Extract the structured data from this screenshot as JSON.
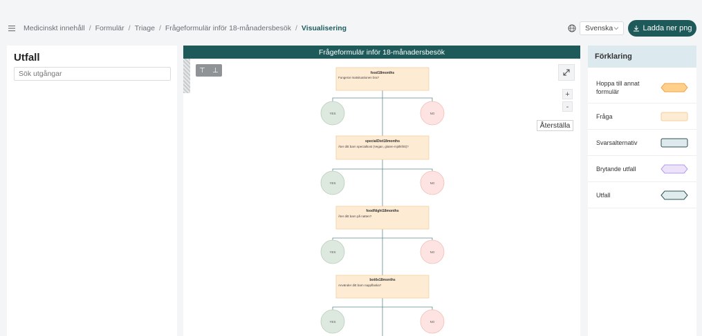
{
  "breadcrumb": {
    "items": [
      "Medicinskt innehåll",
      "Formulär",
      "Triage",
      "Frågeformulär inför 18-månadersbesök"
    ],
    "current": "Visualisering",
    "separator": "/"
  },
  "header": {
    "language": "Svenska",
    "download_label": "Ladda ner png"
  },
  "left_panel": {
    "title": "Utfall",
    "search_placeholder": "Sök utgångar"
  },
  "canvas": {
    "title": "Frågeformulär inför 18-månadersbesök",
    "align_top": "⊤",
    "align_bottom": "⊥",
    "zoom_in": "+",
    "zoom_out": "-",
    "reset_label": "Återställa",
    "questions": [
      {
        "id": "food18months",
        "text": "Fungerar matsituationen bra?"
      },
      {
        "id": "specialDiet18months",
        "text": "Äter ditt barn specialkost (Vegan, gluten-mjölkfritt)?"
      },
      {
        "id": "foodNight18months",
        "text": "Äter ditt barn på natten?"
      },
      {
        "id": "bottle18months",
        "text": "Använder ditt barn nappflaska?"
      }
    ],
    "yes_label": "YES",
    "no_label": "NO"
  },
  "legend": {
    "title": "Förklaring",
    "items": [
      {
        "label": "Hoppa till annat formulär",
        "shape": "hexagon",
        "fill": "#ffd08a",
        "stroke": "#f0a347"
      },
      {
        "label": "Fråga",
        "shape": "rect",
        "fill": "#fdebd3",
        "stroke": "#f3cf9e"
      },
      {
        "label": "Svarsalternativ",
        "shape": "rect",
        "fill": "#dde9ec",
        "stroke": "#2f4f55"
      },
      {
        "label": "Brytande utfall",
        "shape": "hexagon",
        "fill": "#ece3fb",
        "stroke": "#b39be6"
      },
      {
        "label": "Utfall",
        "shape": "hexagon",
        "fill": "#dfecee",
        "stroke": "#2f4f55"
      }
    ]
  },
  "colors": {
    "brand": "#1e5a5a",
    "question_fill": "#fdebd3",
    "yes_fill": "#dde9df",
    "no_fill": "#fde4e2"
  }
}
